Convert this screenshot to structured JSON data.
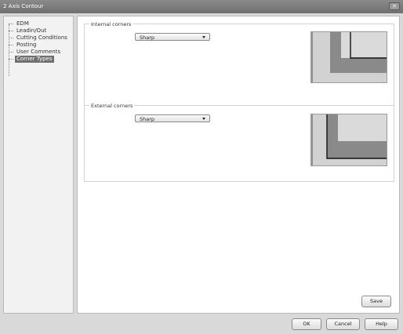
{
  "window": {
    "title": "2 Axis Contour",
    "close_label": "✕"
  },
  "tree": {
    "items": [
      {
        "label": "EDM"
      },
      {
        "label": "Leadin/Out"
      },
      {
        "label": "Cutting Conditions"
      },
      {
        "label": "Posting"
      },
      {
        "label": "User Comments"
      },
      {
        "label": "Corner Types",
        "selected": true
      }
    ]
  },
  "internal_corners": {
    "title": "Internal corners",
    "selected_value": "Sharp",
    "preview_icon": "internal-corner-preview"
  },
  "external_corners": {
    "title": "External corners",
    "selected_value": "Sharp",
    "preview_icon": "external-corner-preview"
  },
  "buttons": {
    "save": "Save",
    "ok": "OK",
    "cancel": "Cancel",
    "help": "Help"
  },
  "colors": {
    "selected_item_bg": "#6f6f6f",
    "preview_dark": "#8a8a8a",
    "preview_light": "#d2d2d2"
  }
}
